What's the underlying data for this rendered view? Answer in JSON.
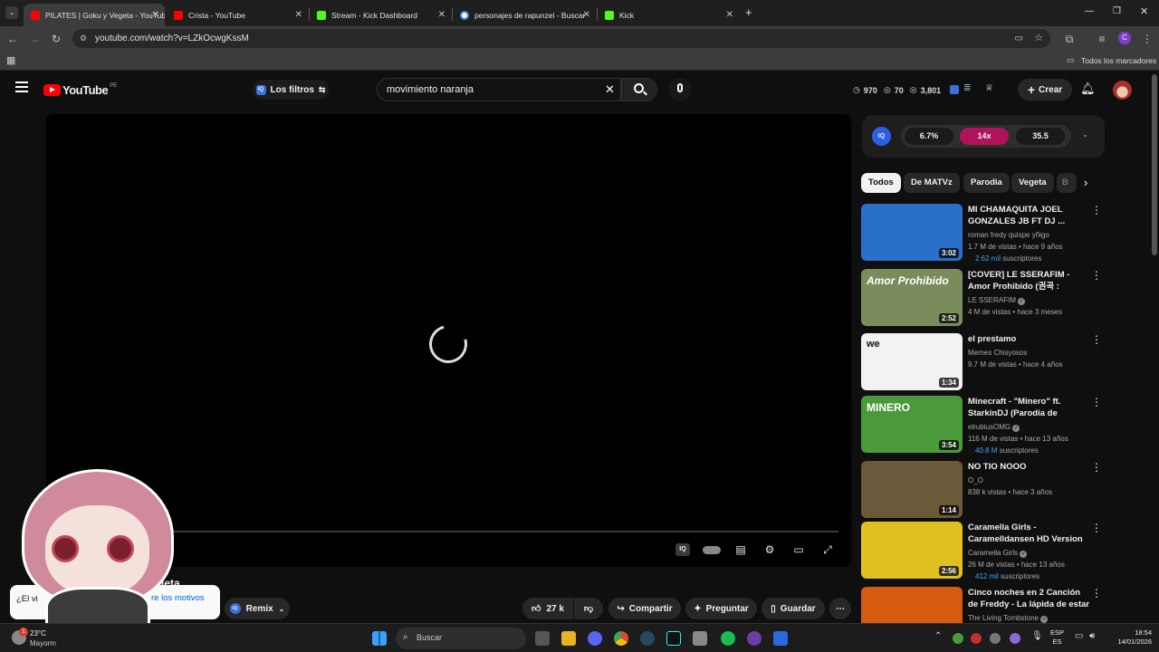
{
  "browser": {
    "tabs": [
      {
        "title": "PILATES | Goku y Vegeta - YouTube",
        "active": true,
        "icon": "youtube-icon"
      },
      {
        "title": "Crista - YouTube",
        "active": false,
        "icon": "youtube-icon"
      },
      {
        "title": "Stream - Kick Dashboard",
        "active": false,
        "icon": "kick-icon"
      },
      {
        "title": "personajes de rapunzel - Buscar",
        "active": false,
        "icon": "google-icon"
      },
      {
        "title": "Kick",
        "active": false,
        "icon": "kick-icon"
      }
    ],
    "new_tab": "+",
    "url": "youtube.com/watch?v=LZkOcwgKssM",
    "bookmarks_label": "Todos los marcadores",
    "colors": {
      "tabstrip": "#1f1f1f",
      "toolbar": "#3c3c3c",
      "profile": "#7b3fd1"
    }
  },
  "youtube": {
    "logo": "YouTube",
    "region": "PE",
    "filters_label": "Los filtros",
    "search_value": "movimiento naranja",
    "stats": {
      "likes": "970",
      "views_a": "70",
      "views_b": "3,801"
    },
    "create_label": "Crear",
    "iq_bar": {
      "badge": "IQ",
      "a": "6.7%",
      "b": "14x",
      "c": "35.5"
    },
    "chips": [
      "Todos",
      "De MATVz",
      "Parodia",
      "Vegeta",
      "B"
    ],
    "recommendations": [
      {
        "title": "MI CHAMAQUITA   JOEL GONZALES  JB FT DJ ...",
        "channel": "roman fredy quispe yñigo",
        "meta": "1.7 M de vistas • hace 9 años",
        "subs_num": "2.62 mil",
        "subs_label": "suscriptores",
        "duration": "3:02",
        "verified": false,
        "thumb_color": "#2a70c8"
      },
      {
        "title": "[COVER] LE SSERAFIM - Amor Prohibido (권곡 : Selena)",
        "channel": "LE SSERAFIM",
        "meta": "4 M de vistas • hace 3 meses",
        "subs_num": "",
        "subs_label": "",
        "duration": "2:52",
        "verified": true,
        "thumb_color": "#7a8c5c",
        "thumb_text": "Amor Prohibido"
      },
      {
        "title": "el prestamo",
        "channel": "Memes Chisyosos",
        "meta": "9.7 M de vistas • hace 4 años",
        "subs_num": "",
        "subs_label": "",
        "duration": "1:34",
        "verified": false,
        "thumb_color": "#f2f2f2",
        "thumb_text": "we"
      },
      {
        "title": "Minecraft - \"Minero\" ft. StarkinDJ (Parodia de \"Torero\"...",
        "channel": "elrubiusOMG",
        "meta": "116 M de vistas • hace 13 años",
        "subs_num": "40.8 M",
        "subs_label": "suscriptores",
        "duration": "3:54",
        "verified": true,
        "thumb_color": "#4a9a3c",
        "thumb_text": "MINERO"
      },
      {
        "title": "NO TIO NOOO",
        "channel": "O_O",
        "meta": "838 k vistas • hace 3 años",
        "subs_num": "",
        "subs_label": "",
        "duration": "1:14",
        "verified": false,
        "thumb_color": "#6a5a3a"
      },
      {
        "title": "Caramella Girls - Caramelldansen HD Version ...",
        "channel": "Caramella Girls",
        "meta": "26 M de vistas • hace 13 años",
        "subs_num": "412 mil",
        "subs_label": "suscriptores",
        "duration": "2:56",
        "verified": true,
        "thumb_color": "#e0c020"
      },
      {
        "title": "Cinco noches en 2 Canción de Freddy - La lápida de estar ...",
        "channel": "The Living Tombstone",
        "meta": "",
        "subs_num": "",
        "subs_label": "",
        "duration": "",
        "verified": true,
        "thumb_color": "#d65a10"
      }
    ],
    "video_title_fragment": "Vegeta",
    "toast": {
      "left": "¿El vi",
      "right": "re los motivos"
    },
    "actions": {
      "remix": "Remix",
      "likes": "27 k",
      "share": "Compartir",
      "ask": "Preguntar",
      "save": "Guardar"
    }
  },
  "taskbar": {
    "weather_temp": "23°C",
    "weather_desc": "Mayorm",
    "notification_count": "1",
    "search_placeholder": "Buscar",
    "lang_a": "ESP",
    "lang_b": "ES",
    "time": "18:54",
    "date": "14/01/2026"
  }
}
